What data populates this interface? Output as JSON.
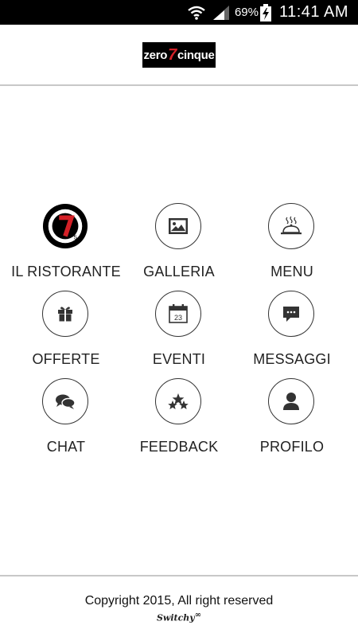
{
  "status_bar": {
    "battery_percent": "69%",
    "time": "11:41 AM",
    "icons": [
      "wifi-icon",
      "signal-icon",
      "battery-charging-icon"
    ]
  },
  "header": {
    "logo": {
      "prefix": "zero",
      "mark": "7",
      "suffix": "cinque"
    }
  },
  "menu": {
    "items": [
      {
        "label": "IL RISTORANTE",
        "icon": "restaurant-logo-icon"
      },
      {
        "label": "GALLERIA",
        "icon": "image-icon"
      },
      {
        "label": "MENU",
        "icon": "cloche-icon"
      },
      {
        "label": "OFFERTE",
        "icon": "gift-icon"
      },
      {
        "label": "EVENTI",
        "icon": "calendar-icon",
        "icon_text": "23"
      },
      {
        "label": "MESSAGGI",
        "icon": "message-icon"
      },
      {
        "label": "CHAT",
        "icon": "chat-icon"
      },
      {
        "label": "FEEDBACK",
        "icon": "stars-icon"
      },
      {
        "label": "PROFILO",
        "icon": "user-icon"
      }
    ]
  },
  "footer": {
    "copyright": "Copyright 2015, All right reserved",
    "brand": "Switchy"
  },
  "colors": {
    "accent": "#d42027",
    "status_bar": "#000000",
    "divider": "#c8c8c8"
  }
}
